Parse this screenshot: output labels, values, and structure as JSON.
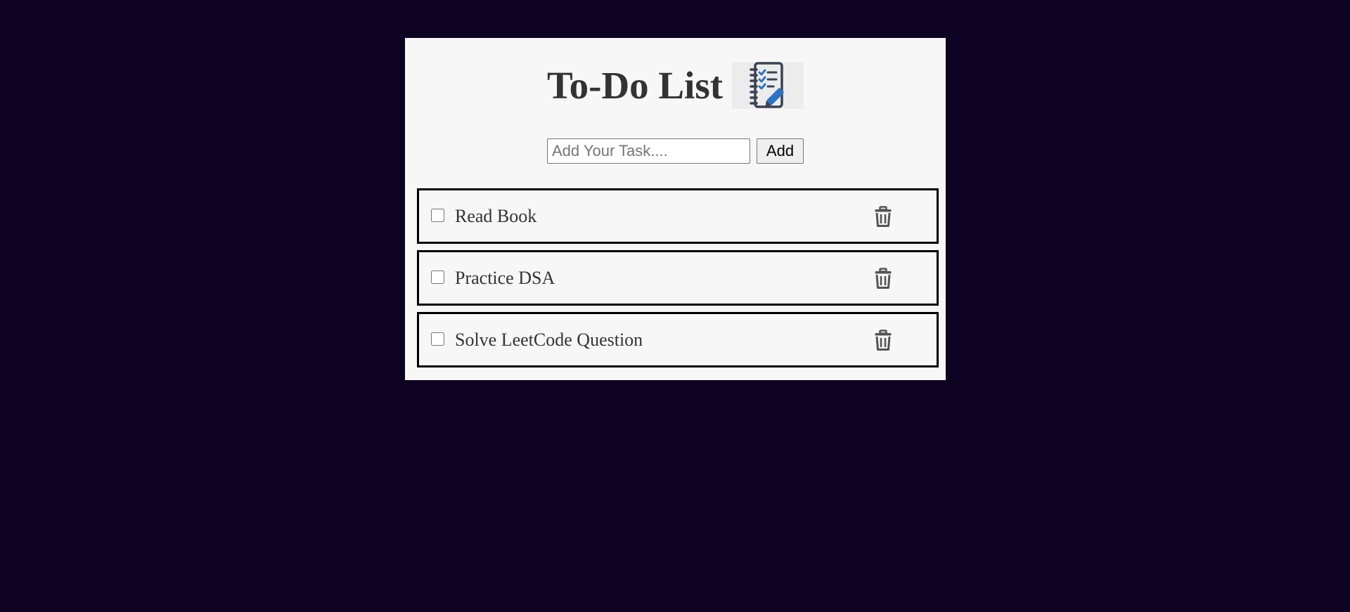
{
  "app": {
    "title": "To-Do List",
    "title_icon": "checklist-notebook-icon"
  },
  "input": {
    "placeholder": "Add Your Task....",
    "value": "",
    "add_label": "Add"
  },
  "tasks": [
    {
      "text": "Read Book",
      "checked": false,
      "delete_icon": "trash-icon"
    },
    {
      "text": "Practice DSA",
      "checked": false,
      "delete_icon": "trash-icon"
    },
    {
      "text": "Solve LeetCode Question",
      "checked": false,
      "delete_icon": "trash-icon"
    }
  ],
  "colors": {
    "page_background": "#0d0221",
    "card_background": "#f7f7f7",
    "text": "#333333",
    "task_border": "#000000",
    "icon_accent": "#2a73c7",
    "icon_dark": "#3b4253",
    "trash": "#555555"
  }
}
